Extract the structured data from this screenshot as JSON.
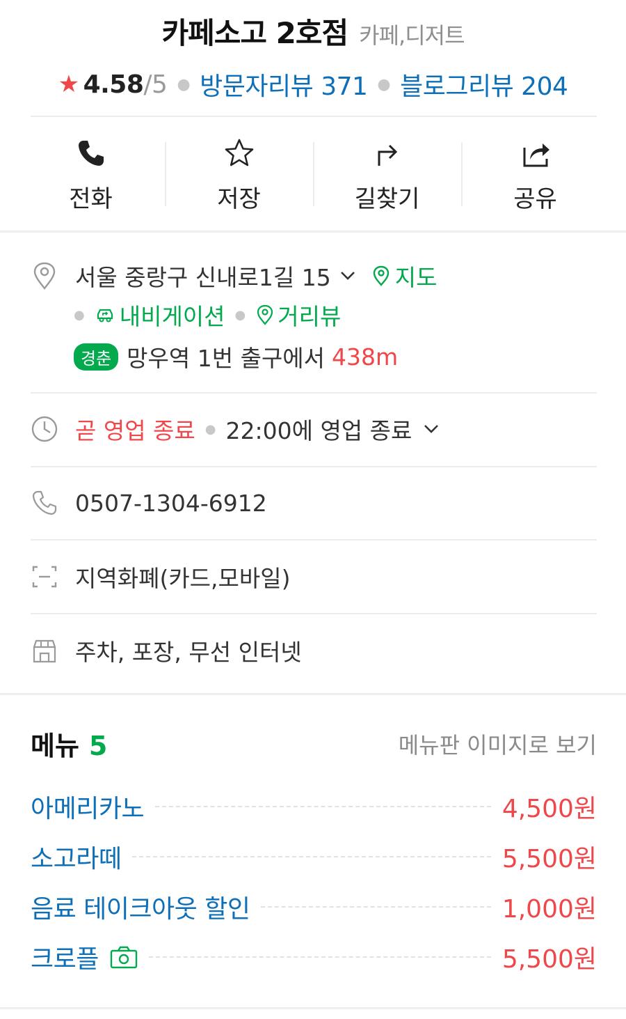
{
  "place": {
    "name": "카페소고 2호점",
    "category": "카페,디저트",
    "rating": "4.58",
    "rating_max": "/5",
    "visitor_reviews": "방문자리뷰 371",
    "blog_reviews": "블로그리뷰 204"
  },
  "actions": [
    {
      "label": "전화",
      "icon": "phone-icon"
    },
    {
      "label": "저장",
      "icon": "star-outline-icon"
    },
    {
      "label": "길찾기",
      "icon": "directions-icon"
    },
    {
      "label": "공유",
      "icon": "share-icon"
    }
  ],
  "address": {
    "text": "서울 중랑구 신내로1길 15",
    "map_label": "지도",
    "navigation_label": "내비게이션",
    "streetview_label": "거리뷰",
    "line_badge": "경춘",
    "station_text": "망우역 1번 출구에서",
    "distance": "438m"
  },
  "hours": {
    "status": "곧 영업 종료",
    "detail": "22:00에 영업 종료"
  },
  "phone": "0507-1304-6912",
  "payment": "지역화폐(카드,모바일)",
  "amenities": "주차, 포장, 무선 인터넷",
  "menu": {
    "title": "메뉴",
    "count": "5",
    "board_link": "메뉴판 이미지로 보기",
    "items": [
      {
        "name": "아메리카노",
        "price": "4,500원"
      },
      {
        "name": "소고라떼",
        "price": "5,500원"
      },
      {
        "name": "음료 테이크아웃 할인",
        "price": "1,000원"
      },
      {
        "name": "크로플",
        "price": "5,500원",
        "has_photo": true
      }
    ]
  },
  "colors": {
    "green": "#03a94d",
    "blue": "#0d6fb8",
    "red": "#f0474b"
  }
}
